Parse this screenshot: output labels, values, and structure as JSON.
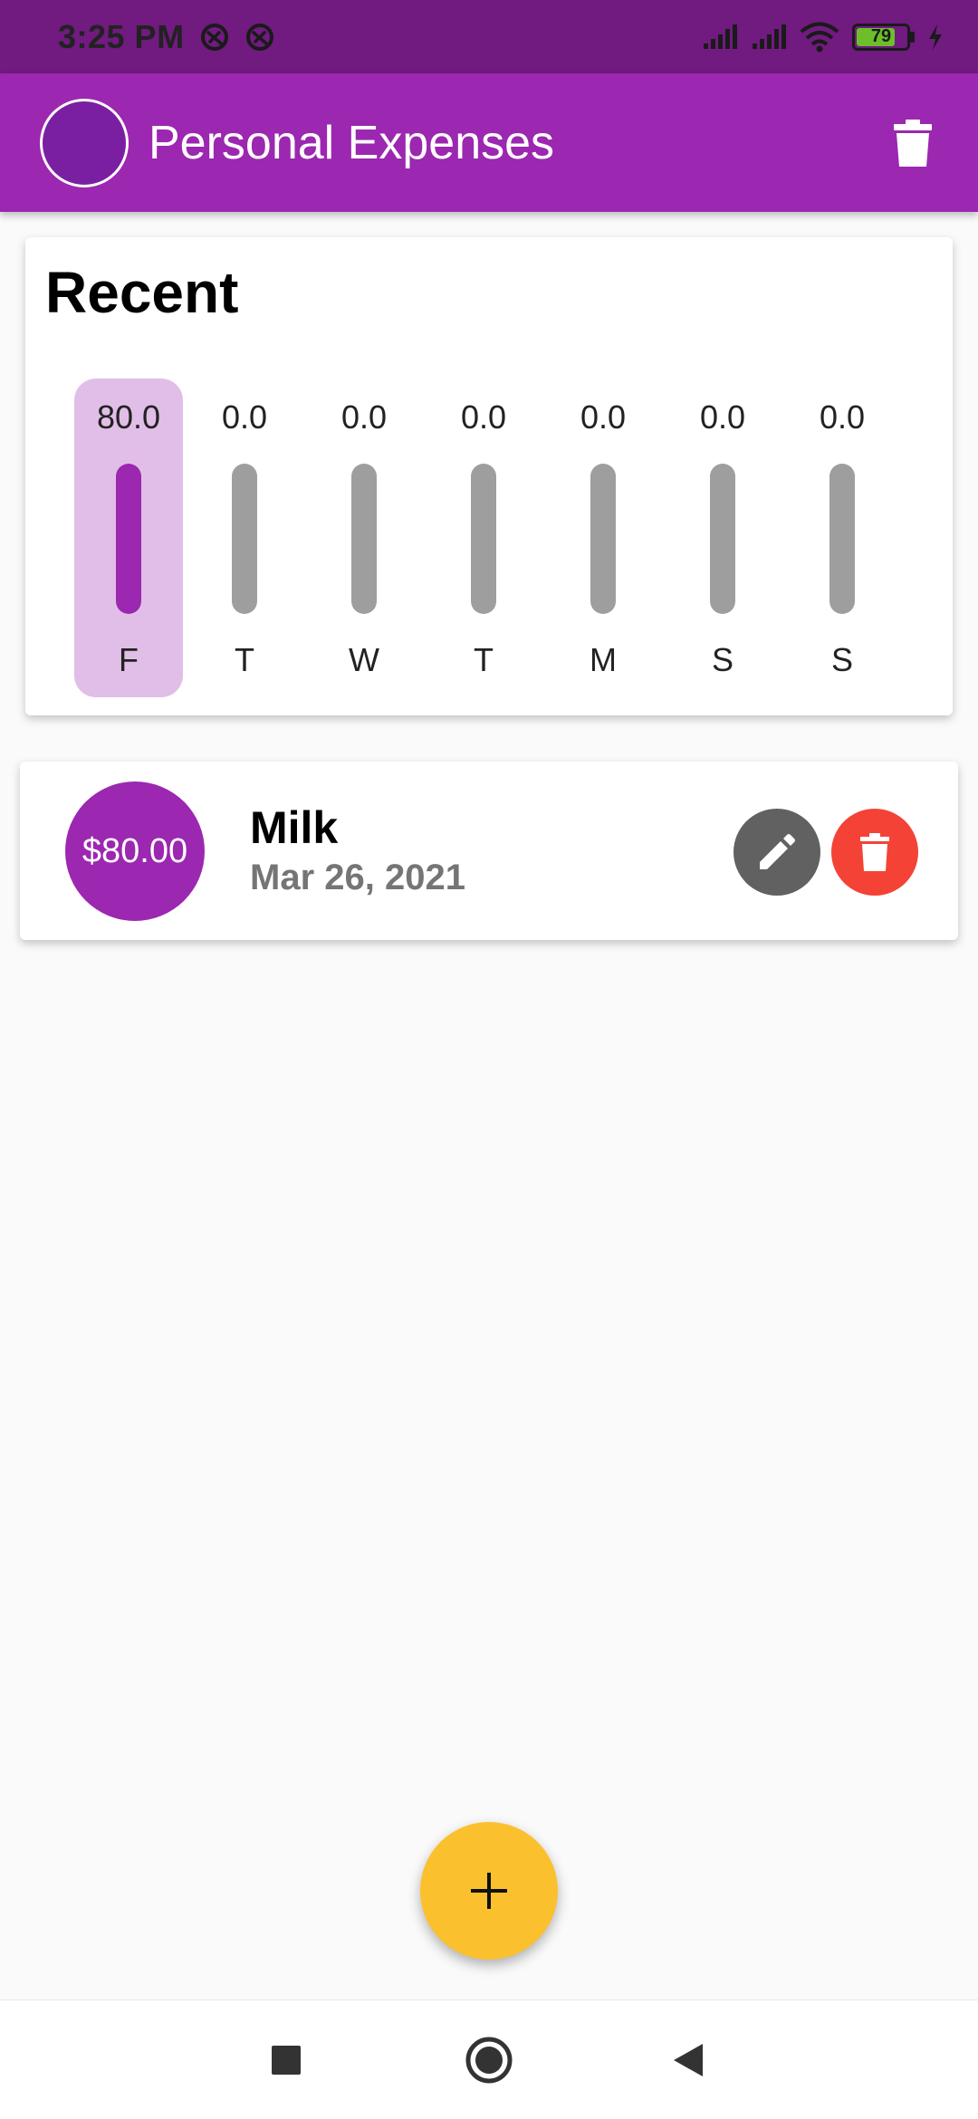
{
  "status_bar": {
    "time": "3:25 PM",
    "battery_level": "79",
    "battery_fraction": 0.79,
    "icons": [
      "vpn-icon",
      "vpn-icon",
      "signal-icon",
      "signal-icon",
      "wifi-icon",
      "battery-icon",
      "charging-icon"
    ]
  },
  "app_bar": {
    "title": "Personal Expenses",
    "avatar_color": "#7b1fa2",
    "background": "#9c27b0",
    "action_icon": "delete-icon"
  },
  "chart": {
    "title": "Recent"
  },
  "chart_data": {
    "type": "bar",
    "title": "Recent",
    "categories": [
      "F",
      "T",
      "W",
      "T",
      "M",
      "S",
      "S"
    ],
    "values": [
      80.0,
      0.0,
      0.0,
      0.0,
      0.0,
      0.0,
      0.0
    ],
    "value_labels": [
      "80.0",
      "0.0",
      "0.0",
      "0.0",
      "0.0",
      "0.0",
      "0.0"
    ],
    "fill_fraction": [
      1.0,
      0,
      0,
      0,
      0,
      0,
      0
    ],
    "highlighted_index": 0,
    "bar_color": "#9c27b0",
    "track_color": "#9e9e9e",
    "highlight_color": "#e1bee7"
  },
  "transactions": [
    {
      "amount": "$80.00",
      "title": "Milk",
      "date": "Mar 26, 2021",
      "edit_icon": "edit-icon",
      "delete_icon": "delete-icon"
    }
  ],
  "fab": {
    "icon": "add-icon",
    "color": "#fbc02d"
  },
  "nav_bar": {
    "icons": [
      "recents-square-icon",
      "home-circle-icon",
      "back-triangle-icon"
    ]
  }
}
